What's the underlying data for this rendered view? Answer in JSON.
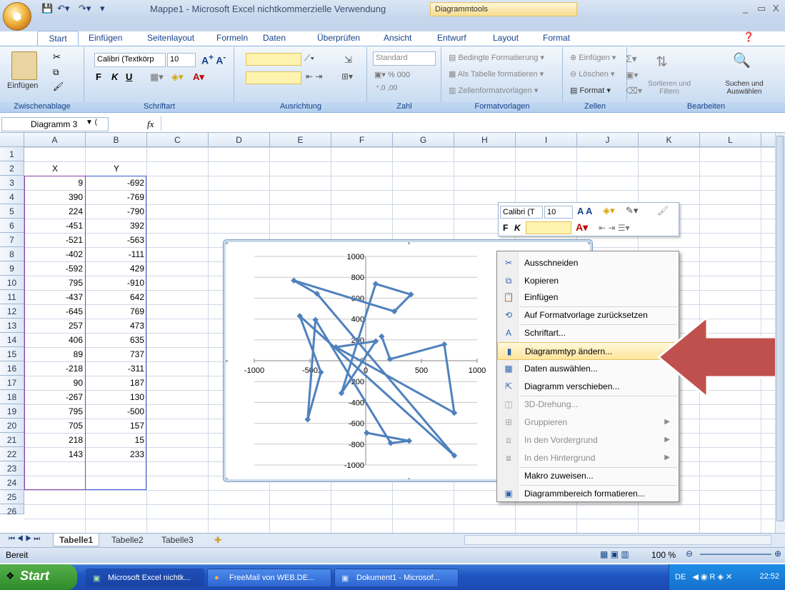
{
  "titlebar": {
    "title": "Mappe1 - Microsoft Excel nichtkommerzielle Verwendung",
    "context_tab_group": "Diagrammtools",
    "min": "_",
    "restore": "▭",
    "close": "X"
  },
  "tabs": [
    "Start",
    "Einfügen",
    "Seitenlayout",
    "Formeln",
    "Daten",
    "Überprüfen",
    "Ansicht",
    "Entwurf",
    "Layout",
    "Format"
  ],
  "ribbon": {
    "clipboard": {
      "paste": "Einfügen",
      "label": "Zwischenablage"
    },
    "font": {
      "name": "Calibri (Textkörp",
      "size": "10",
      "bold": "F",
      "italic": "K",
      "underline": "U",
      "label": "Schriftart"
    },
    "alignment": {
      "label": "Ausrichtung"
    },
    "number": {
      "format": "Standard",
      "label": "Zahl"
    },
    "styles": {
      "cond": "Bedingte Formatierung",
      "table": "Als Tabelle formatieren",
      "cell": "Zellenformatvorlagen",
      "label": "Formatvorlagen"
    },
    "cells": {
      "insert": "Einfügen",
      "delete": "Löschen",
      "format": "Format",
      "label": "Zellen"
    },
    "editing": {
      "sort": "Sortieren und Filtern",
      "find": "Suchen und Auswählen",
      "label": "Bearbeiten"
    }
  },
  "formulabar": {
    "namebox": "Diagramm 3",
    "fx": "fx",
    "value": ""
  },
  "columns": [
    "A",
    "B",
    "C",
    "D",
    "E",
    "F",
    "G",
    "H",
    "I",
    "J",
    "K",
    "L"
  ],
  "rows": [
    "1",
    "2",
    "3",
    "4",
    "5",
    "6",
    "7",
    "8",
    "9",
    "10",
    "11",
    "12",
    "13",
    "14",
    "15",
    "16",
    "17",
    "18",
    "19",
    "20",
    "21",
    "22",
    "23",
    "24",
    "25",
    "26"
  ],
  "table": {
    "header_x": "X",
    "header_y": "Y",
    "x": [
      "9",
      "390",
      "224",
      "-451",
      "-521",
      "-402",
      "-592",
      "795",
      "-437",
      "-645",
      "257",
      "406",
      "89",
      "-218",
      "90",
      "-267",
      "795",
      "705",
      "218",
      "143"
    ],
    "y": [
      "-692",
      "-769",
      "-790",
      "392",
      "-563",
      "-111",
      "429",
      "-910",
      "642",
      "769",
      "473",
      "635",
      "737",
      "-311",
      "187",
      "130",
      "-500",
      "157",
      "15",
      "233"
    ]
  },
  "chart_data": {
    "type": "line",
    "x": [
      9,
      390,
      224,
      -451,
      -521,
      -402,
      -592,
      795,
      -437,
      -645,
      257,
      406,
      89,
      -218,
      90,
      -267,
      795,
      705,
      218,
      143
    ],
    "y": [
      -692,
      -769,
      -790,
      392,
      -563,
      -111,
      429,
      -910,
      642,
      769,
      473,
      635,
      737,
      -311,
      187,
      130,
      -500,
      157,
      15,
      233
    ],
    "xlim": [
      -1000,
      1000
    ],
    "ylim": [
      -1000,
      1000
    ],
    "x_ticks": [
      "-1000",
      "-500",
      "0",
      "500",
      "1000"
    ],
    "y_ticks": [
      "1000",
      "800",
      "600",
      "400",
      "200",
      "0",
      "-200",
      "-400",
      "-600",
      "-800",
      "-1000"
    ],
    "grid": true,
    "color": "#4f81bd"
  },
  "mini_toolbar": {
    "font": "Calibri (T",
    "size": "10",
    "bold": "F",
    "italic": "K"
  },
  "context_menu": {
    "items": [
      {
        "label": "Ausschneiden",
        "icon": "scissors-icon",
        "disabled": false
      },
      {
        "label": "Kopieren",
        "icon": "copy-icon",
        "disabled": false
      },
      {
        "label": "Einfügen",
        "icon": "paste-icon",
        "disabled": false
      },
      {
        "label": "Auf Formatvorlage zurücksetzen",
        "icon": "reset-style-icon",
        "disabled": false
      },
      {
        "label": "Schriftart...",
        "icon": "font-icon",
        "disabled": false
      },
      {
        "label": "Diagrammtyp ändern...",
        "icon": "chart-type-icon",
        "disabled": false,
        "highlighted": true
      },
      {
        "label": "Daten auswählen...",
        "icon": "select-data-icon",
        "disabled": false
      },
      {
        "label": "Diagramm verschieben...",
        "icon": "move-chart-icon",
        "disabled": false
      },
      {
        "label": "3D-Drehung...",
        "icon": "rotate-3d-icon",
        "disabled": true
      },
      {
        "label": "Gruppieren",
        "icon": "group-icon",
        "disabled": true
      },
      {
        "label": "In den Vordergrund",
        "icon": "bring-front-icon",
        "disabled": true
      },
      {
        "label": "In den Hintergrund",
        "icon": "send-back-icon",
        "disabled": true
      },
      {
        "label": "Makro zuweisen...",
        "icon": "",
        "disabled": false
      },
      {
        "label": "Diagrammbereich formatieren...",
        "icon": "format-area-icon",
        "disabled": false
      }
    ]
  },
  "sheets": [
    "Tabelle1",
    "Tabelle2",
    "Tabelle3"
  ],
  "status": {
    "text": "Bereit",
    "zoom": "100 %"
  },
  "taskbar": {
    "start": "Start",
    "buttons": [
      "Microsoft Excel nichtk...",
      "FreeMail von WEB.DE...",
      "Dokument1 - Microsof..."
    ],
    "lang": "DE",
    "clock": "22:52"
  },
  "colors": {
    "accent": "#15428b",
    "series": "#4f81bd",
    "highlight_arrow": "#c0504d"
  }
}
